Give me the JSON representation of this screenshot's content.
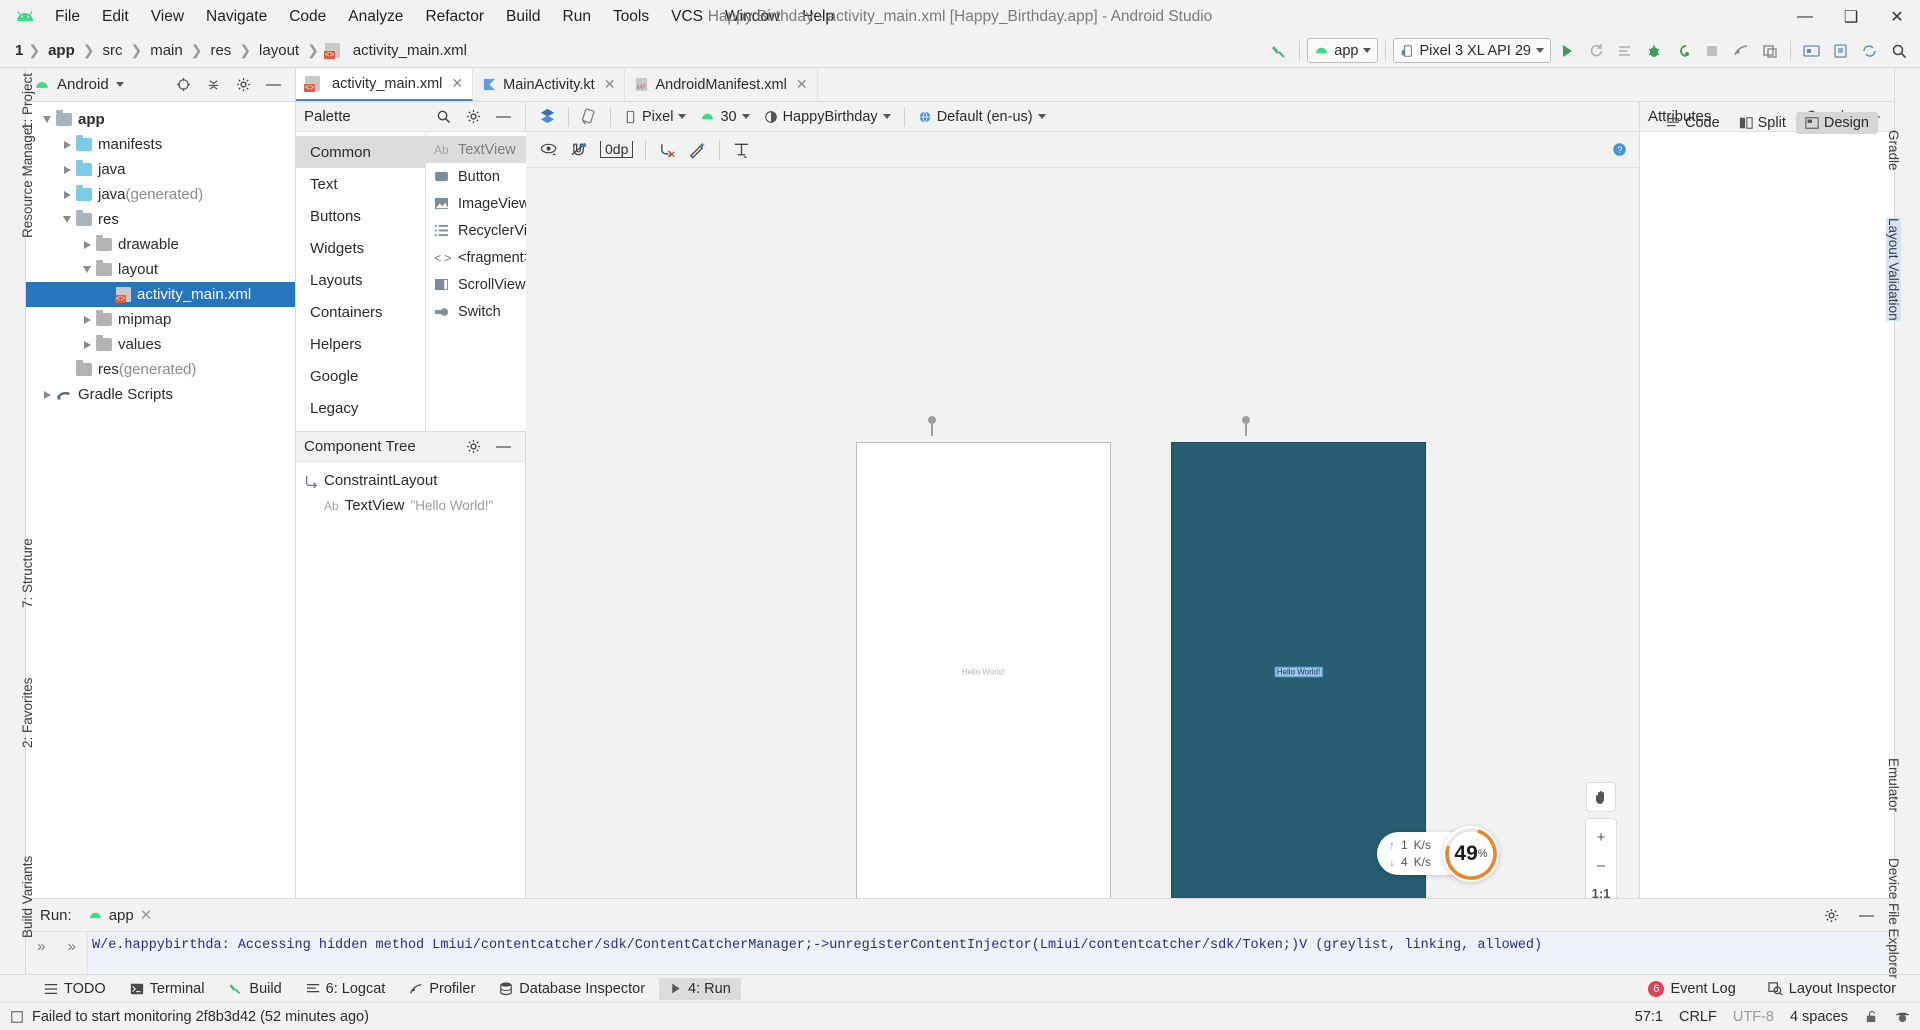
{
  "window": {
    "title": "Happy Birthday - activity_main.xml [Happy_Birthday.app] - Android Studio",
    "minimize": "—",
    "maximize": "❑",
    "close": "✕"
  },
  "menu": [
    "File",
    "Edit",
    "View",
    "Navigate",
    "Code",
    "Analyze",
    "Refactor",
    "Build",
    "Run",
    "Tools",
    "VCS",
    "Window",
    "Help"
  ],
  "breadcrumb": {
    "num": "1",
    "items": [
      "app",
      "src",
      "main",
      "res",
      "layout",
      "activity_main.xml"
    ]
  },
  "toolbar": {
    "module_combo": "app",
    "device_combo": "Pixel 3 XL API 29",
    "run_icon": "run-icon",
    "rerun_icon": "rerun-icon",
    "apply_icon": "apply-changes-icon",
    "debug_icon": "debug-icon",
    "attach_icon": "attach-debugger-icon",
    "profiler_icon": "profiler-icon",
    "layout_inspector_icon": "layout-inspector-icon",
    "stop_icon": "stop-icon",
    "avd_icon": "avd-manager-icon",
    "sdk_icon": "sdk-manager-icon",
    "sync_icon": "sync-gradle-icon",
    "search_icon": "search-icon"
  },
  "project_panel": {
    "title": "Android",
    "header_icons": [
      "target-icon",
      "collapse-all-icon",
      "settings-icon",
      "hide-icon"
    ],
    "tree": [
      {
        "label": "app",
        "depth": 0,
        "twisty": "down",
        "icon": "module-folder",
        "bold": true
      },
      {
        "label": "manifests",
        "depth": 1,
        "twisty": "right",
        "icon": "folder-blue"
      },
      {
        "label": "java",
        "depth": 1,
        "twisty": "right",
        "icon": "folder-blue"
      },
      {
        "label": "java",
        "suffix": " (generated)",
        "depth": 1,
        "twisty": "right",
        "icon": "folder-gen"
      },
      {
        "label": "res",
        "depth": 1,
        "twisty": "down",
        "icon": "folder-res"
      },
      {
        "label": "drawable",
        "depth": 2,
        "twisty": "right",
        "icon": "folder-gray"
      },
      {
        "label": "layout",
        "depth": 2,
        "twisty": "down",
        "icon": "folder-gray"
      },
      {
        "label": "activity_main.xml",
        "depth": 3,
        "twisty": "none",
        "icon": "xml-file",
        "selected": true
      },
      {
        "label": "mipmap",
        "depth": 2,
        "twisty": "right",
        "icon": "folder-gray"
      },
      {
        "label": "values",
        "depth": 2,
        "twisty": "right",
        "icon": "folder-gray"
      },
      {
        "label": "res",
        "suffix": " (generated)",
        "depth": 1,
        "twisty": "none",
        "icon": "folder-gray"
      },
      {
        "label": "Gradle Scripts",
        "depth": 0,
        "twisty": "right",
        "icon": "gradle-icon"
      }
    ]
  },
  "editor_tabs": [
    {
      "label": "activity_main.xml",
      "icon": "xml-layout-icon",
      "active": true,
      "closable": true
    },
    {
      "label": "MainActivity.kt",
      "icon": "kotlin-icon",
      "active": false,
      "closable": true
    },
    {
      "label": "AndroidManifest.xml",
      "icon": "manifest-icon",
      "active": false,
      "closable": true
    }
  ],
  "view_modes": [
    {
      "label": "Code",
      "icon": "code-mode-icon",
      "active": false
    },
    {
      "label": "Split",
      "icon": "split-mode-icon",
      "active": false
    },
    {
      "label": "Design",
      "icon": "design-mode-icon",
      "active": true
    }
  ],
  "palette": {
    "title": "Palette",
    "header_icons": [
      "search-icon",
      "settings-icon",
      "hide-icon"
    ],
    "categories": [
      {
        "label": "Common",
        "selected": true
      },
      {
        "label": "Text",
        "selected": false
      },
      {
        "label": "Buttons",
        "selected": false
      },
      {
        "label": "Widgets",
        "selected": false
      },
      {
        "label": "Layouts",
        "selected": false
      },
      {
        "label": "Containers",
        "selected": false
      },
      {
        "label": "Helpers",
        "selected": false
      },
      {
        "label": "Google",
        "selected": false
      },
      {
        "label": "Legacy",
        "selected": false
      }
    ],
    "items": [
      {
        "label": "TextView",
        "icon": "textview-icon",
        "selected": true
      },
      {
        "label": "Button",
        "icon": "button-icon",
        "selected": false
      },
      {
        "label": "ImageView",
        "icon": "imageview-icon",
        "selected": false
      },
      {
        "label": "RecyclerVi...",
        "icon": "recyclerview-icon",
        "selected": false
      },
      {
        "label": "<fragment>",
        "icon": "fragment-icon",
        "selected": false
      },
      {
        "label": "ScrollView",
        "icon": "scrollview-icon",
        "selected": false
      },
      {
        "label": "Switch",
        "icon": "switch-icon",
        "selected": false
      }
    ]
  },
  "component_tree": {
    "title": "Component Tree",
    "header_icons": [
      "settings-icon",
      "hide-icon"
    ],
    "nodes": [
      {
        "label": "ConstraintLayout",
        "icon": "constraintlayout-icon",
        "depth": 0,
        "value": ""
      },
      {
        "label": "TextView",
        "icon": "textview-icon",
        "depth": 1,
        "value": "\"Hello World!\""
      }
    ]
  },
  "design_surface": {
    "toolbar": {
      "design_mode_icon": "design-blueprint-icon",
      "orientation_icon": "rotate-orientation-icon",
      "device": "Pixel",
      "api_level": "30",
      "theme": "HappyBirthday",
      "locale": "Default (en-us)",
      "info_icon": "info-icon"
    },
    "constraint_toolbar": {
      "visibility_icon": "eye-icon",
      "autoconnect_icon": "autoconnect-magnet-icon",
      "margin_value": "0dp",
      "clear_constraints_icon": "clear-constraints-icon",
      "infer_constraints_icon": "infer-constraints-magic-icon",
      "align_icon": "align-vertical-icon",
      "help_icon": "help-icon"
    },
    "preview_text": "Hello World!",
    "blueprint_text": "Hello World!",
    "blueprint_color": "#265d72",
    "zoom_controls": [
      {
        "label": "✋",
        "name": "pan-tool-button"
      },
      {
        "label": "+",
        "name": "zoom-in-button"
      },
      {
        "label": "–",
        "name": "zoom-out-button"
      },
      {
        "label": "1:1",
        "name": "zoom-actual-size-button"
      },
      {
        "label": "⤡",
        "name": "zoom-to-fit-button"
      }
    ]
  },
  "network_widget": {
    "upload": "1",
    "upload_unit": "K/s",
    "download": "4",
    "download_unit": "K/s",
    "percent": "49",
    "percent_symbol": "%",
    "accent": "#e8872a"
  },
  "attributes": {
    "title": "Attributes",
    "header_icons": [
      "search-icon",
      "settings-icon",
      "hide-icon"
    ]
  },
  "left_strip": [
    {
      "label": "1: Project",
      "selected": false
    },
    {
      "label": "Resource Manager",
      "selected": false
    },
    {
      "label": "7: Structure",
      "selected": false
    },
    {
      "label": "2: Favorites",
      "selected": false
    },
    {
      "label": "Build Variants",
      "selected": false
    }
  ],
  "right_strip": [
    {
      "label": "Gradle",
      "selected": false
    },
    {
      "label": "Layout Validation",
      "selected": true
    },
    {
      "label": "Emulator",
      "selected": false
    },
    {
      "label": "Device File Explorer",
      "selected": false
    }
  ],
  "run_panel": {
    "label": "Run:",
    "tab": "app",
    "log": "W/e.happybirthda: Accessing hidden method Lmiui/contentcatcher/sdk/ContentCatcherManager;->unregisterContentInjector(Lmiui/contentcatcher/sdk/Token;)V (greylist, linking, allowed)",
    "settings_icon": "settings-icon",
    "hide_icon": "hide-icon"
  },
  "tool_strip": [
    {
      "label": "TODO",
      "icon": "todo-icon",
      "active": false
    },
    {
      "label": "Terminal",
      "icon": "terminal-icon",
      "active": false
    },
    {
      "label": "Build",
      "icon": "build-icon",
      "active": false
    },
    {
      "label": "6: Logcat",
      "icon": "logcat-icon",
      "active": false
    },
    {
      "label": "Profiler",
      "icon": "profiler-icon",
      "active": false
    },
    {
      "label": "Database Inspector",
      "icon": "database-icon",
      "active": false
    },
    {
      "label": "4: Run",
      "icon": "run-icon",
      "active": true
    }
  ],
  "tool_strip_right": [
    {
      "label": "Event Log",
      "icon": "event-log-icon",
      "badge": "6"
    },
    {
      "label": "Layout Inspector",
      "icon": "layout-inspector-icon",
      "badge": ""
    }
  ],
  "status_bar": {
    "message": "Failed to start monitoring 2f8b3d42 (52 minutes ago)",
    "caret": "57:1",
    "line_sep": "CRLF",
    "encoding": "UTF-8",
    "indent": "4 spaces",
    "lock_icon": "unlocked-icon",
    "inspector_icon": "hector-inspection-icon"
  }
}
